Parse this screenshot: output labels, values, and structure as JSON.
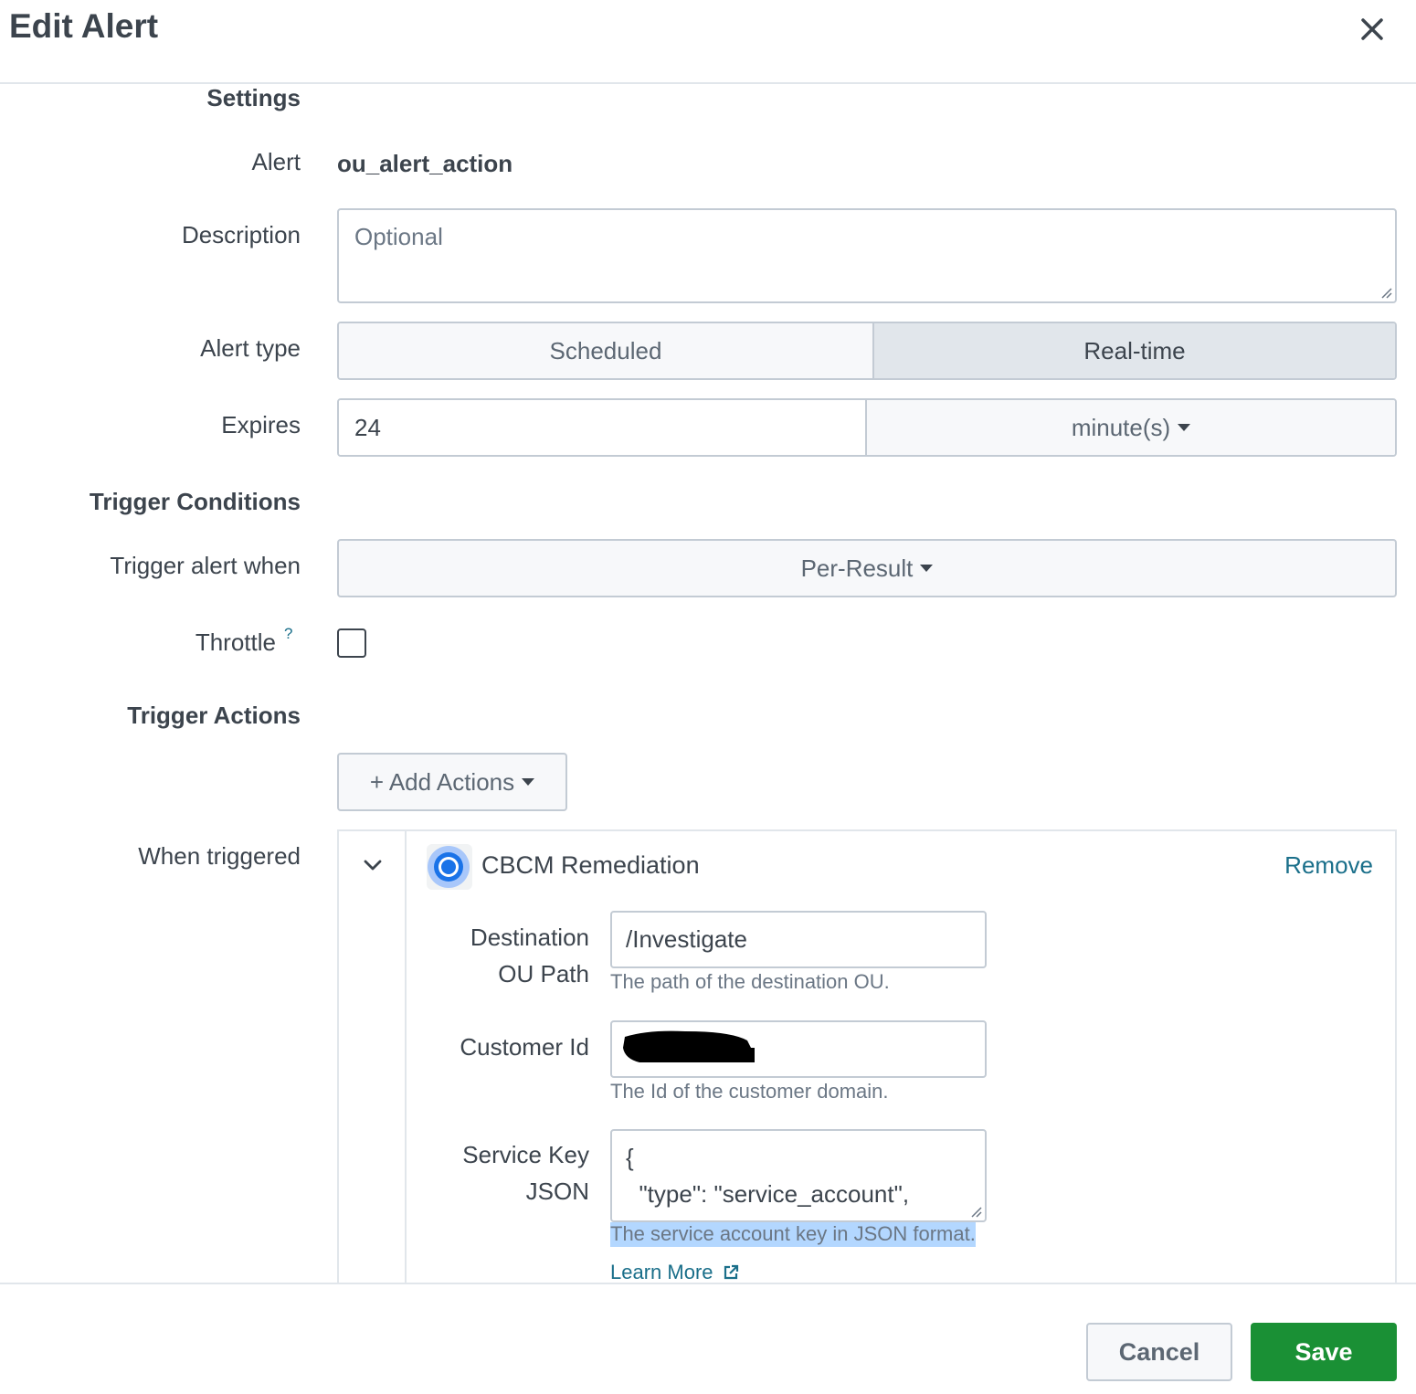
{
  "header": {
    "title": "Edit Alert"
  },
  "sections": {
    "settings": "Settings",
    "trigger_conditions": "Trigger Conditions",
    "trigger_actions": "Trigger Actions"
  },
  "fields": {
    "alert": {
      "label": "Alert",
      "value": "ou_alert_action"
    },
    "description": {
      "label": "Description",
      "placeholder": "Optional",
      "value": ""
    },
    "alert_type": {
      "label": "Alert type",
      "options": [
        "Scheduled",
        "Real-time"
      ],
      "selected": "Real-time"
    },
    "expires": {
      "label": "Expires",
      "value": "24",
      "unit": "minute(s)"
    },
    "trigger_when": {
      "label": "Trigger alert when",
      "value": "Per-Result"
    },
    "throttle": {
      "label": "Throttle",
      "help": "?",
      "checked": false
    },
    "add_actions": {
      "label": "+ Add Actions"
    },
    "when_triggered": {
      "label": "When triggered"
    }
  },
  "action": {
    "name": "CBCM Remediation",
    "remove_label": "Remove",
    "logo": "chrome-logo-icon",
    "destination": {
      "label_line1": "Destination",
      "label_line2": "OU Path",
      "value": "/Investigate",
      "help": "The path of the destination OU."
    },
    "customer_id": {
      "label": "Customer Id",
      "value_redacted": true,
      "help": "The Id of the customer domain."
    },
    "service_key": {
      "label_line1": "Service Key",
      "label_line2": "JSON",
      "line1": "{",
      "line2": "  \"type\": \"service_account\",",
      "help": "The service account key in JSON format.",
      "learn_more": "Learn More"
    }
  },
  "footer": {
    "cancel": "Cancel",
    "save": "Save"
  },
  "colors": {
    "text": "#3c444d",
    "muted": "#6b7785",
    "border": "#c3cbd4",
    "link": "#1a6f8a",
    "primary": "#1a9035",
    "selected_segment": "#e1e6eb",
    "highlight": "#b3d7ff"
  }
}
